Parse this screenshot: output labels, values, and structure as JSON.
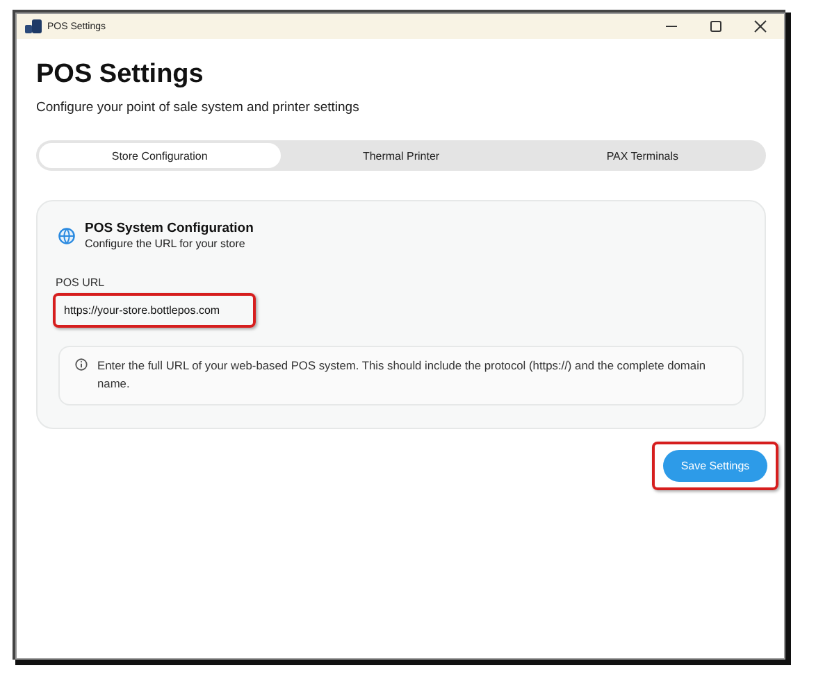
{
  "window": {
    "title": "POS Settings"
  },
  "header": {
    "title": "POS Settings",
    "subtitle": "Configure your point of sale system and printer settings"
  },
  "tabs": [
    {
      "label": "Store Configuration",
      "selected": true
    },
    {
      "label": "Thermal Printer",
      "selected": false
    },
    {
      "label": "PAX Terminals",
      "selected": false
    }
  ],
  "card": {
    "title": "POS System Configuration",
    "subtitle": "Configure the URL for your store",
    "field": {
      "label": "POS URL",
      "value": "https://your-store.bottlepos.com",
      "highlighted": true
    },
    "info": "Enter the full URL of your web-based POS system. This should include the protocol (https://) and the complete domain name."
  },
  "save_button": {
    "label": "Save Settings",
    "highlighted": true
  }
}
